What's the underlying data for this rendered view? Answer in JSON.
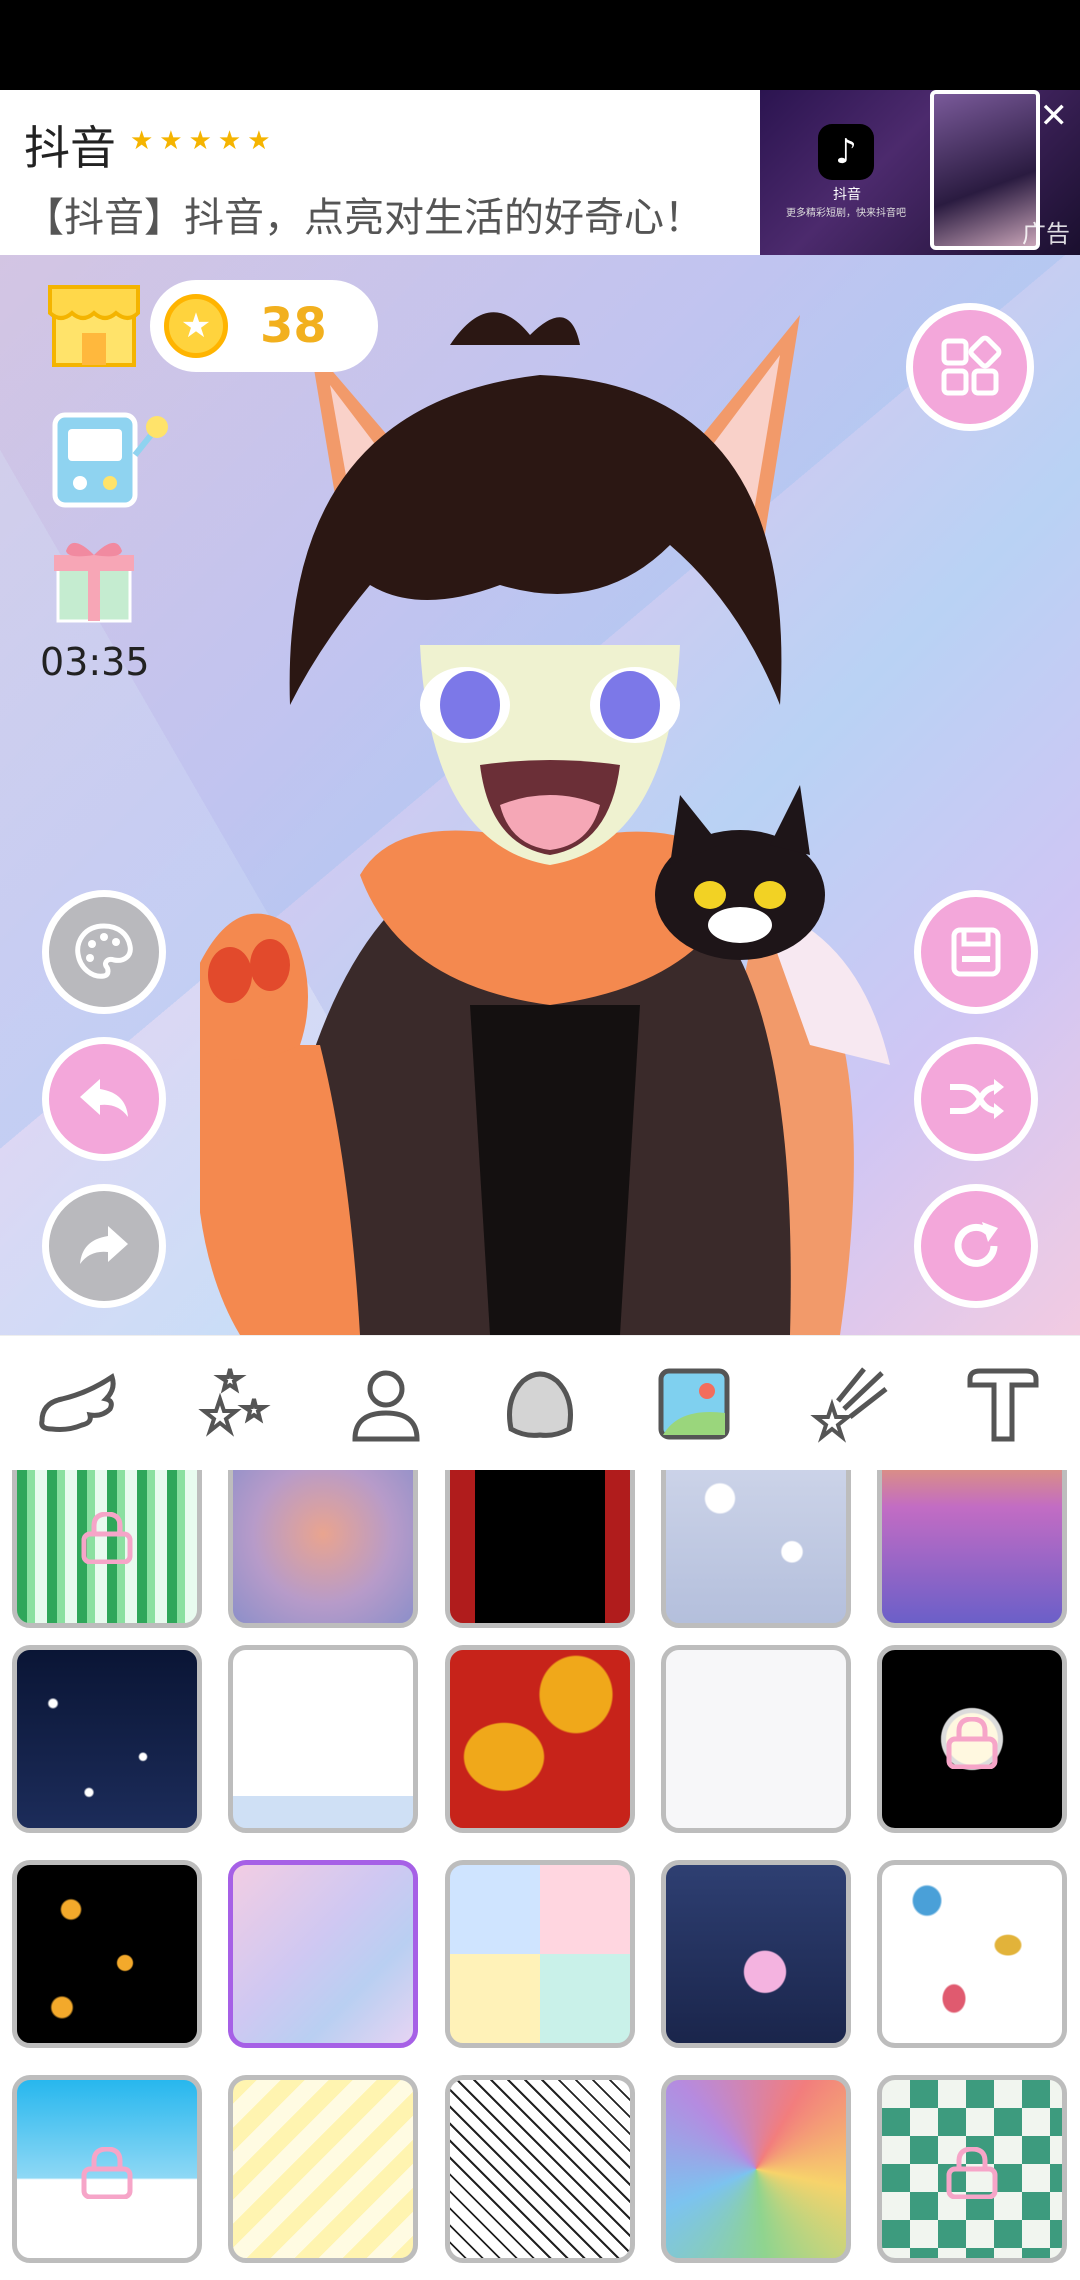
{
  "ad": {
    "title": "抖音",
    "stars": "★★★★★",
    "description": "【抖音】抖音，点亮对生活的好奇心！",
    "logo_text": "抖音",
    "sub_text": "更多精彩短剧，快来抖音吧",
    "close": "✕",
    "tag": "广告"
  },
  "toolbar": {
    "coins": "38",
    "timer": "03:35"
  },
  "tabs": [
    "wings-icon",
    "stars-icon",
    "person-icon",
    "head-icon",
    "background-icon",
    "shooting-star-icon",
    "text-icon"
  ],
  "selected_tab": "background-icon",
  "colors": {
    "accent_pink": "#f3a7da",
    "selected_border": "#a660e6",
    "coin_text": "#f2b01e"
  },
  "background_tiles": [
    {
      "name": "bamboo",
      "locked": true
    },
    {
      "name": "pink-clouds",
      "locked": false
    },
    {
      "name": "red-curtain",
      "locked": false
    },
    {
      "name": "bokeh",
      "locked": false
    },
    {
      "name": "purple-sparkle",
      "locked": false
    },
    {
      "name": "starry-night",
      "locked": false
    },
    {
      "name": "white-waves",
      "locked": false
    },
    {
      "name": "red-lanterns",
      "locked": false
    },
    {
      "name": "birds",
      "locked": false
    },
    {
      "name": "spider-web",
      "locked": true
    },
    {
      "name": "shooting-stars",
      "locked": false
    },
    {
      "name": "pastel-polygon",
      "locked": false,
      "selected": true
    },
    {
      "name": "pastel-squares",
      "locked": false
    },
    {
      "name": "jellyfish",
      "locked": false
    },
    {
      "name": "fish",
      "locked": false
    },
    {
      "name": "sky-clouds",
      "locked": true
    },
    {
      "name": "yellow-triangles",
      "locked": false
    },
    {
      "name": "triangle-lines",
      "locked": false
    },
    {
      "name": "stained-glass",
      "locked": false
    },
    {
      "name": "green-diamonds",
      "locked": true
    }
  ]
}
